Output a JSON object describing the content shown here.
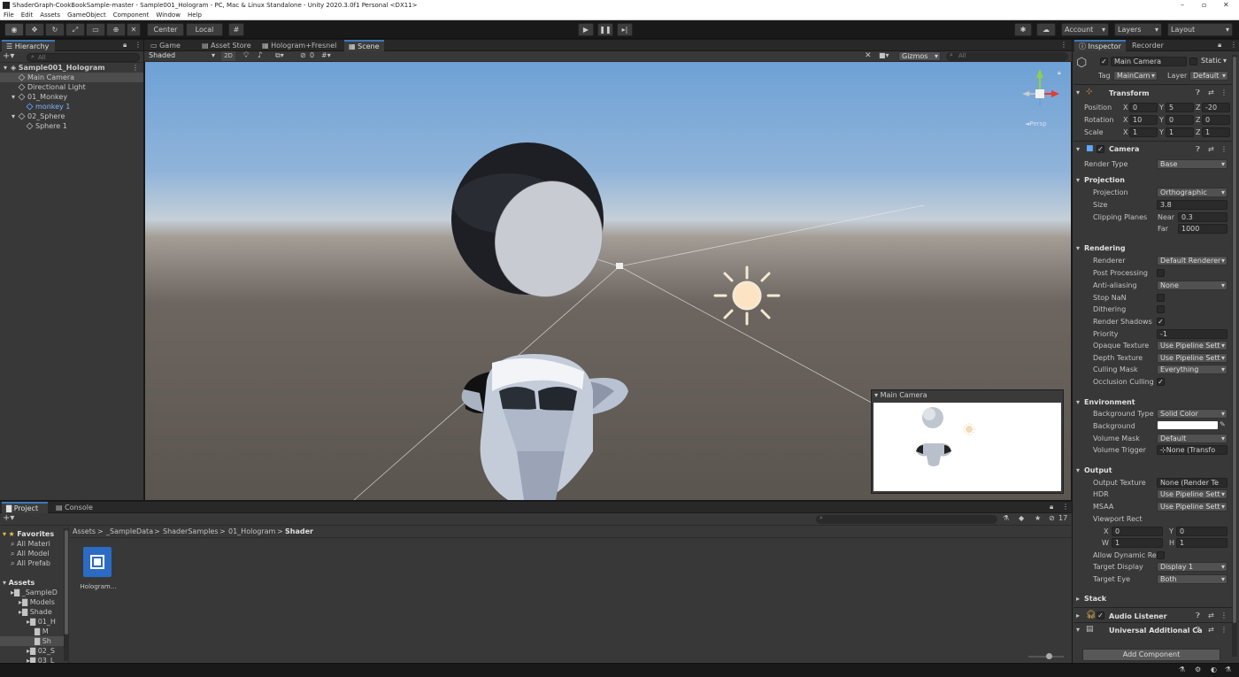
{
  "window": {
    "title": "ShaderGraph-CookBookSample-master - Sample001_Hologram - PC, Mac & Linux Standalone - Unity 2020.3.0f1 Personal <DX11>",
    "minimize": "–",
    "maximize": "▫",
    "close": "✕"
  },
  "menu": [
    "File",
    "Edit",
    "Assets",
    "GameObject",
    "Component",
    "Window",
    "Help"
  ],
  "toolbar": {
    "center": "Center",
    "local": "Local",
    "account": "Account",
    "layers": "Layers",
    "layout": "Layout"
  },
  "hierarchy": {
    "tab": "Hierarchy",
    "search_placeholder": "All",
    "rows": [
      {
        "label": "Sample001_Hologram",
        "indent": 0,
        "type": "scene",
        "bold": true
      },
      {
        "label": "Main Camera",
        "indent": 1,
        "type": "go",
        "selected": true
      },
      {
        "label": "Directional Light",
        "indent": 1,
        "type": "go"
      },
      {
        "label": "01_Monkey",
        "indent": 1,
        "type": "go",
        "fold": true
      },
      {
        "label": "monkey 1",
        "indent": 2,
        "type": "prefab"
      },
      {
        "label": "02_Sphere",
        "indent": 1,
        "type": "go",
        "fold": true
      },
      {
        "label": "Sphere 1",
        "indent": 2,
        "type": "go"
      }
    ]
  },
  "scene_tabs": [
    "Game",
    "Asset Store",
    "Hologram+Fresnel",
    "Scene"
  ],
  "scene_toolbar": {
    "shading": "Shaded",
    "mode2d": "2D",
    "hidden_count": "0",
    "gizmos": "Gizmos",
    "search_placeholder": "All"
  },
  "gizmo": {
    "persp": "◄Persp"
  },
  "camera_preview": {
    "title": "Main Camera"
  },
  "project": {
    "tabs": [
      "Project",
      "Console"
    ],
    "count": "17",
    "breadcrumb": [
      "Assets",
      "_SampleData",
      "ShaderSamples",
      "01_Hologram",
      "Shader"
    ],
    "tree": [
      {
        "label": "Favorites",
        "indent": 0,
        "bold": true
      },
      {
        "label": "All Materi",
        "indent": 1
      },
      {
        "label": "All Model",
        "indent": 1
      },
      {
        "label": "All Prefab",
        "indent": 1
      },
      {
        "label": "Assets",
        "indent": 0,
        "bold": true
      },
      {
        "label": "_SampleD",
        "indent": 1
      },
      {
        "label": "Models",
        "indent": 2
      },
      {
        "label": "Shade",
        "indent": 2
      },
      {
        "label": "01_H",
        "indent": 3
      },
      {
        "label": "M",
        "indent": 4
      },
      {
        "label": "Sh",
        "indent": 4,
        "selected": true
      },
      {
        "label": "02_S",
        "indent": 3
      },
      {
        "label": "03_L",
        "indent": 3
      }
    ],
    "asset": {
      "label": "Hologram..."
    }
  },
  "inspector": {
    "tabs": [
      "Inspector",
      "Recorder"
    ],
    "object_name": "Main Camera",
    "static": "Static",
    "tag_label": "Tag",
    "tag": "MainCam",
    "layer_label": "Layer",
    "layer": "Default",
    "transform": {
      "title": "Transform",
      "position_label": "Position",
      "rotation_label": "Rotation",
      "scale_label": "Scale",
      "position": {
        "x": "0",
        "y": "5",
        "z": "-20"
      },
      "rotation": {
        "x": "10",
        "y": "0",
        "z": "0"
      },
      "scale": {
        "x": "1",
        "y": "1",
        "z": "1"
      }
    },
    "camera": {
      "title": "Camera",
      "render_type_label": "Render Type",
      "render_type": "Base",
      "projection_section": "Projection",
      "projection_label": "Projection",
      "projection": "Orthographic",
      "size_label": "Size",
      "size": "3.8",
      "clipping_label": "Clipping Planes",
      "near_label": "Near",
      "near": "0.3",
      "far_label": "Far",
      "far": "1000",
      "rendering_section": "Rendering",
      "renderer_label": "Renderer",
      "renderer": "Default Renderer",
      "post_processing_label": "Post Processing",
      "antialiasing_label": "Anti-aliasing",
      "antialiasing": "None",
      "stop_nan_label": "Stop NaN",
      "dithering_label": "Dithering",
      "render_shadows_label": "Render Shadows",
      "priority_label": "Priority",
      "priority": "-1",
      "opaque_texture_label": "Opaque Texture",
      "opaque_texture": "Use Pipeline Sett",
      "depth_texture_label": "Depth Texture",
      "depth_texture": "Use Pipeline Sett",
      "culling_mask_label": "Culling Mask",
      "culling_mask": "Everything",
      "occlusion_label": "Occlusion Culling",
      "environment_section": "Environment",
      "background_type_label": "Background Type",
      "background_type": "Solid Color",
      "background_label": "Background",
      "background_color": "#FFFFFF",
      "volume_mask_label": "Volume Mask",
      "volume_mask": "Default",
      "volume_trigger_label": "Volume Trigger",
      "volume_trigger": "None (Transfo",
      "output_section": "Output",
      "output_texture_label": "Output Texture",
      "output_texture": "None (Render Te",
      "hdr_label": "HDR",
      "hdr": "Use Pipeline Sett",
      "msaa_label": "MSAA",
      "msaa": "Use Pipeline Sett",
      "viewport_label": "Viewport Rect",
      "vx": "0",
      "vy": "0",
      "vw": "1",
      "vh": "1",
      "allow_dynamic_label": "Allow Dynamic Re",
      "target_display_label": "Target Display",
      "target_display": "Display 1",
      "target_eye_label": "Target Eye",
      "target_eye": "Both",
      "stack_section": "Stack"
    },
    "audio_listener": "Audio Listener",
    "universal": "Universal Additional Ca",
    "add_component": "Add Component"
  },
  "colors": {
    "accent": "#3a79bb",
    "selection": "#2c5d87",
    "panel": "#383838",
    "header": "#282828"
  }
}
